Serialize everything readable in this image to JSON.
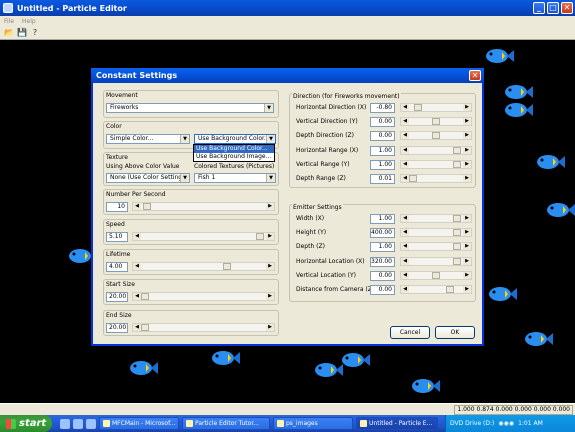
{
  "app": {
    "title": "Untitled - Particle Editor",
    "menu": [
      "File",
      "Help"
    ],
    "toolbar_icons": [
      "open-icon",
      "save-icon",
      "help-icon"
    ]
  },
  "status": {
    "coords": "1.000 0.874 0.000 0.000 0.000 0.000"
  },
  "taskbar": {
    "start_label": "start",
    "items": [
      {
        "label": "MFCMain - Microsof...",
        "active": false
      },
      {
        "label": "Particle Editor Tutor...",
        "active": false
      },
      {
        "label": "ps_images",
        "active": false
      },
      {
        "label": "Untitled - Particle E...",
        "active": true
      }
    ],
    "tray_text": "DVD Drive (D:)",
    "clock": "1:01 AM"
  },
  "dialog": {
    "title": "Constant Settings",
    "movement": {
      "label": "Movement",
      "value": "Fireworks"
    },
    "color": {
      "label": "Color",
      "value": "Simple Color...",
      "bg_value": "Use Background Color...",
      "bg_options": [
        "Use Background Color...",
        "Use Background Image..."
      ]
    },
    "texture": {
      "label": "Texture",
      "sub_left": "Using Above Color Value",
      "sub_right": "Colored Textures (Pictures)",
      "left_value": "None (Use Color Settings)",
      "right_value": "Fish 1"
    },
    "number_per_second": {
      "label": "Number Per Second",
      "value": "10",
      "level": 0.02
    },
    "speed": {
      "label": "Speed",
      "value": "5.10",
      "level": 0.98
    },
    "lifetime": {
      "label": "Lifetime",
      "value": "4.00",
      "level": 0.7
    },
    "start_size": {
      "label": "Start Size",
      "value": "20.00",
      "level": 0.0
    },
    "end_size": {
      "label": "End Size",
      "value": "20.00",
      "level": 0.0
    },
    "direction": {
      "label": "Direction (for Fireworks movement)",
      "fields": [
        {
          "label": "Horizontal Direction (X)",
          "value": "-0.80",
          "level": 0.1
        },
        {
          "label": "Vertical Direction (Y)",
          "value": "0.00",
          "level": 0.5
        },
        {
          "label": "Depth Direction (Z)",
          "value": "0.00",
          "level": 0.5
        },
        {
          "label": "Horizontal Range (X)",
          "value": "1.00",
          "level": 0.95
        },
        {
          "label": "Vertical Range (Y)",
          "value": "1.00",
          "level": 0.95
        },
        {
          "label": "Depth Range (Z)",
          "value": "0.01",
          "level": 0.0
        }
      ]
    },
    "emitter": {
      "label": "Emitter Settings",
      "fields": [
        {
          "label": "Width (X)",
          "value": "1.00",
          "level": 0.95
        },
        {
          "label": "Height (Y)",
          "value": "400.00",
          "level": 0.95
        },
        {
          "label": "Depth (Z)",
          "value": "1.00",
          "level": 0.95
        },
        {
          "label": "Horizontal Location (X)",
          "value": "320.00",
          "level": 0.95
        },
        {
          "label": "Vertical Location (Y)",
          "value": "0.00",
          "level": 0.5
        },
        {
          "label": "Distance from Camera (Z)",
          "value": "0.00",
          "level": 0.8
        }
      ]
    },
    "cancel_label": "Cancel",
    "ok_label": "OK"
  }
}
